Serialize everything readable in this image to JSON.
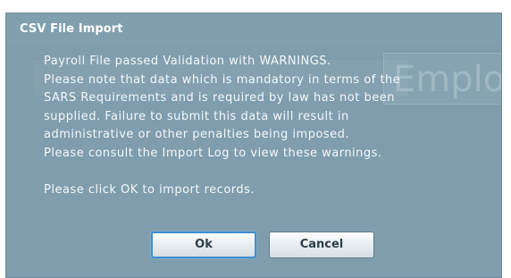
{
  "dialog": {
    "title": "CSV File Import",
    "background_watermark": "Emplo",
    "message_lines": [
      "Payroll File passed Validation with WARNINGS.",
      "Please note that data which is mandatory in terms of the",
      "SARS Requirements and is required by law has not been",
      "supplied. Failure to submit this data will result in",
      "administrative or other penalties being imposed.",
      "Please consult the Import Log to view these warnings."
    ],
    "prompt": "Please click OK to import records.",
    "buttons": {
      "ok_label": "Ok",
      "cancel_label": "Cancel"
    }
  },
  "colors": {
    "dialog_background": "#7f9dad",
    "text": "#f4f8fa",
    "ok_focus_border": "#3f8fce"
  }
}
